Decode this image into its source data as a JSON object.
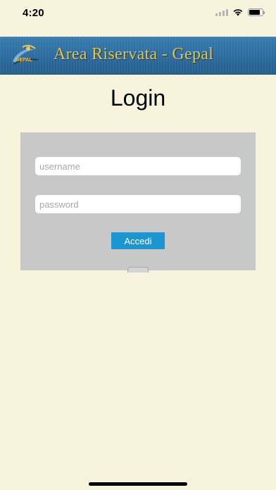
{
  "status_bar": {
    "time": "4:20",
    "icons": [
      "signal-icon",
      "wifi-icon",
      "battery-icon"
    ]
  },
  "banner": {
    "title": "Area Riservata - Gepal",
    "logo_text": "GEPAL",
    "colors": {
      "background": "#2e6fa3",
      "title": "#e9c23a"
    }
  },
  "login": {
    "title": "Login",
    "username_placeholder": "username",
    "password_placeholder": "password",
    "username_value": "",
    "password_value": "",
    "submit_label": "Accedi"
  },
  "colors": {
    "page_background": "#f6f4dc",
    "panel_background": "#c8c8c8",
    "button_background": "#1a96d2"
  }
}
